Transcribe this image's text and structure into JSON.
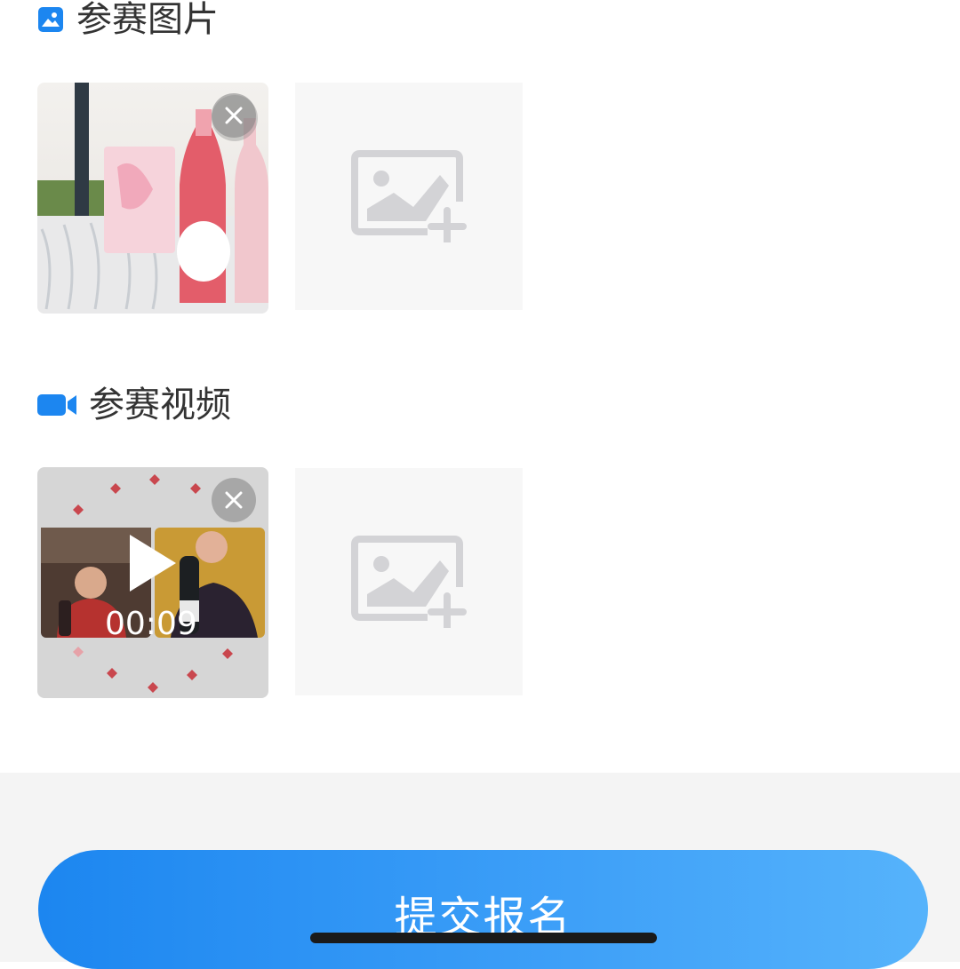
{
  "photos_section": {
    "title": "参赛图片",
    "icon": "image-icon"
  },
  "video_section": {
    "title": "参赛视频",
    "icon": "video-camera-icon"
  },
  "video": {
    "duration": "00:09"
  },
  "submit": {
    "label": "提交报名"
  },
  "colors": {
    "accent": "#1c86f0",
    "accent_end": "#56b3fb",
    "placeholder": "#d3d3d6"
  }
}
